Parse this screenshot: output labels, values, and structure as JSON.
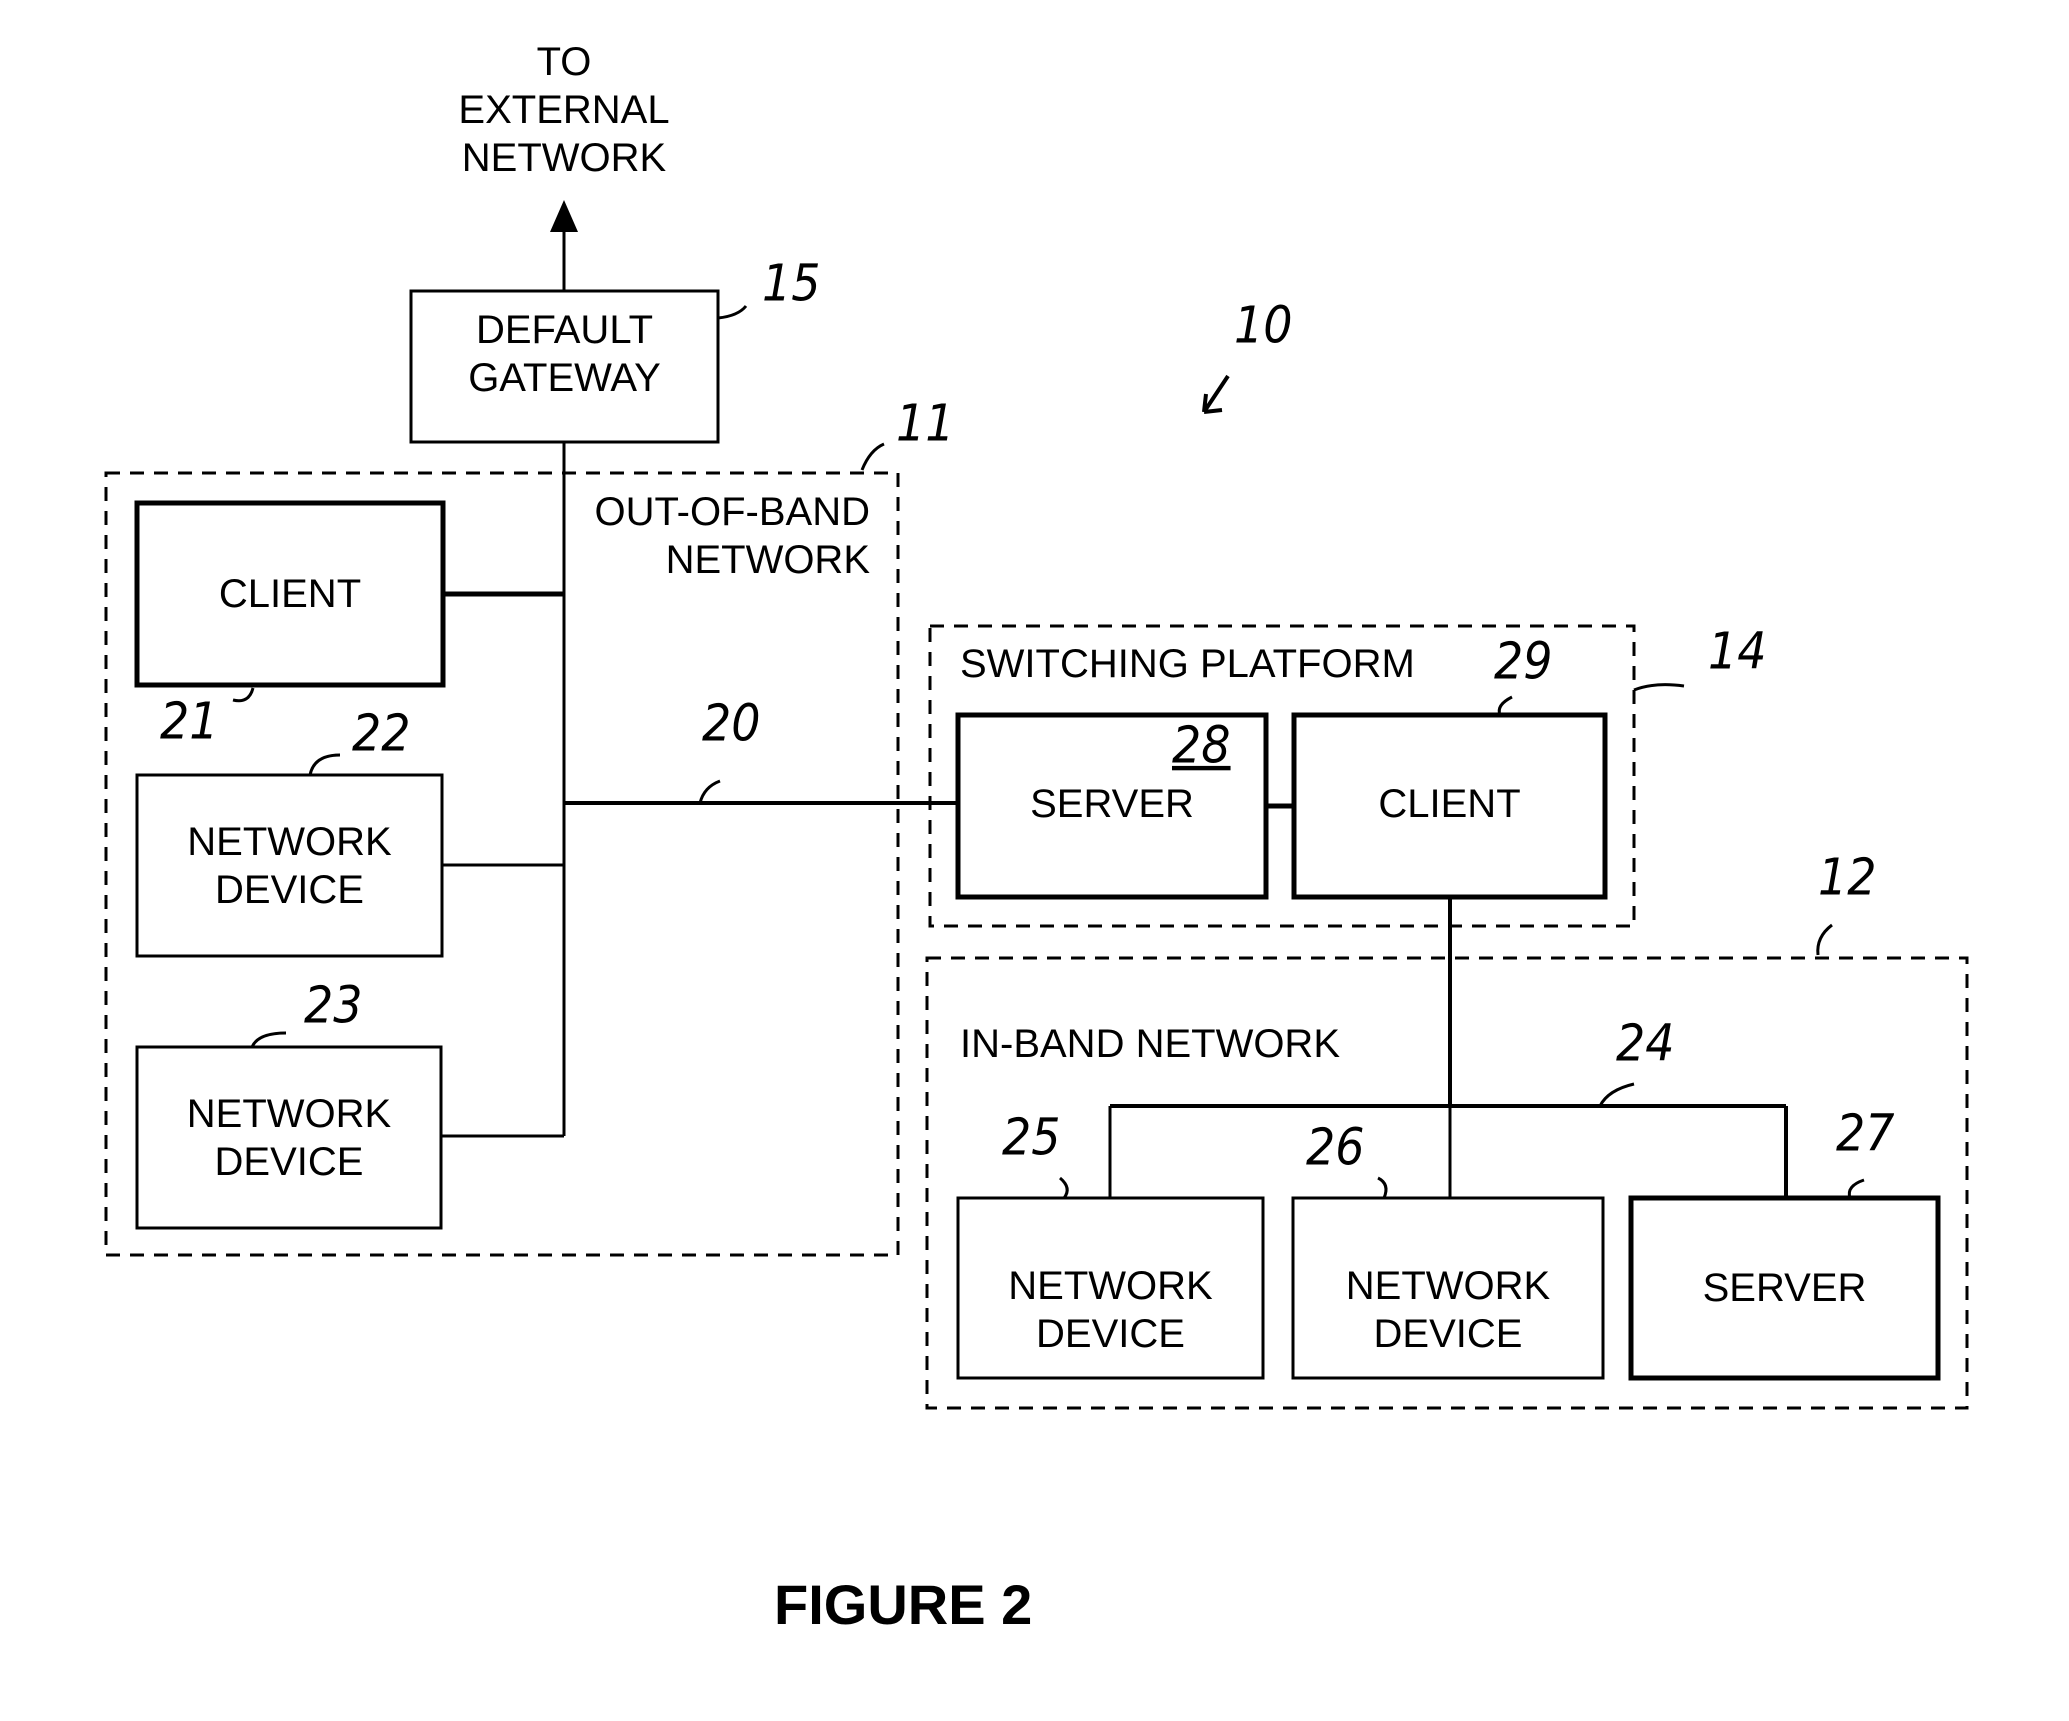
{
  "figure_title": "FIGURE 2",
  "system_ref": "10",
  "external": {
    "label": "TO\nEXTERNAL\nNETWORK"
  },
  "gateway": {
    "label": "DEFAULT\nGATEWAY",
    "ref": "15"
  },
  "out_of_band": {
    "label": "OUT-OF-BAND\nNETWORK",
    "ref": "11",
    "bus_ref": "20",
    "nodes": [
      {
        "label": "CLIENT",
        "ref": "21"
      },
      {
        "label": "NETWORK\nDEVICE",
        "ref": "22"
      },
      {
        "label": "NETWORK\nDEVICE",
        "ref": "23"
      }
    ]
  },
  "switching_platform": {
    "label": "SWITCHING PLATFORM",
    "ref": "14",
    "server": {
      "label": "SERVER",
      "ref": "28"
    },
    "client": {
      "label": "CLIENT",
      "ref": "29"
    }
  },
  "in_band": {
    "label": "IN-BAND NETWORK",
    "ref": "12",
    "bus_ref": "24",
    "nodes": [
      {
        "label": "NETWORK\nDEVICE",
        "ref": "25"
      },
      {
        "label": "NETWORK\nDEVICE",
        "ref": "26"
      },
      {
        "label": "SERVER",
        "ref": "27"
      }
    ]
  }
}
